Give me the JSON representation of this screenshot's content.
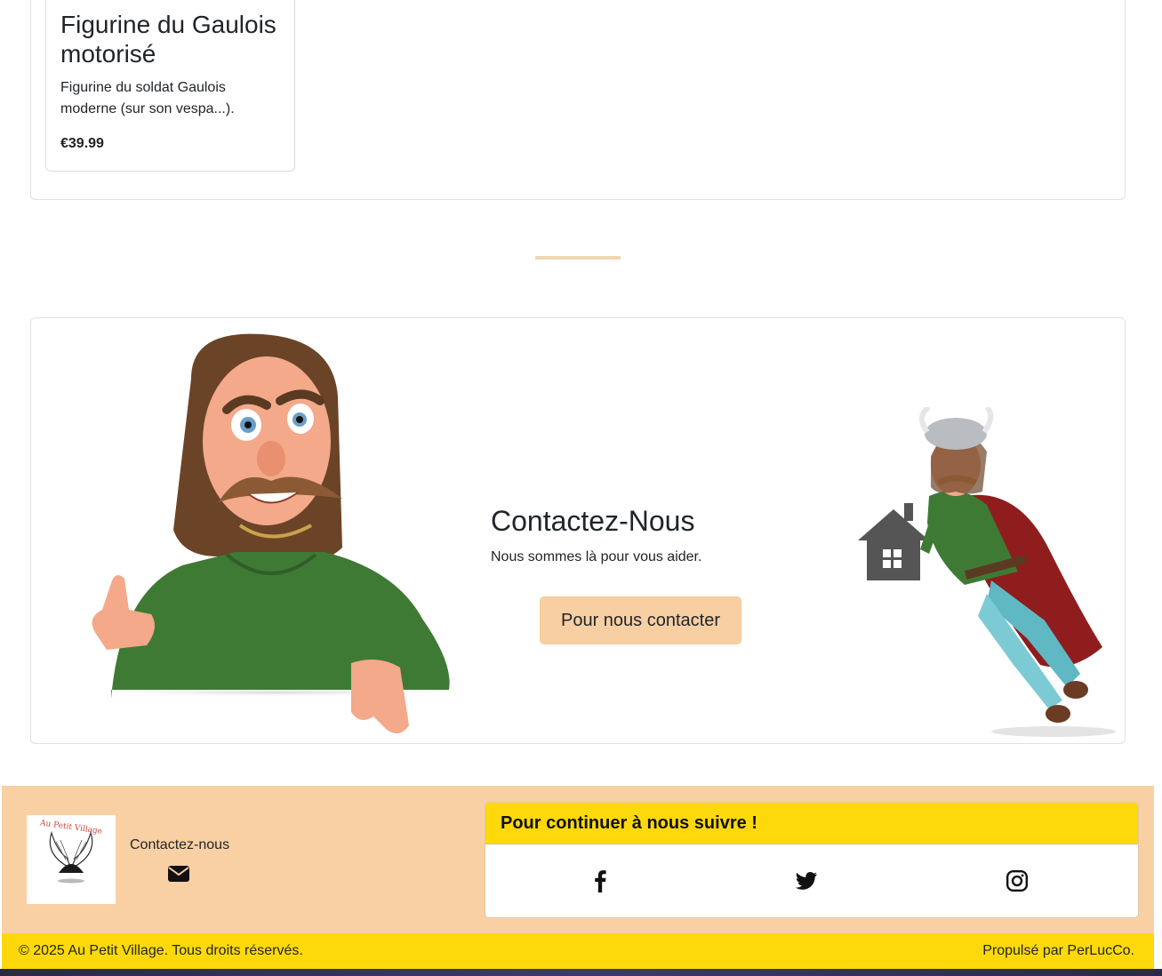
{
  "product": {
    "title": "Figurine du Gaulois motorisé",
    "description": "Figurine du soldat Gaulois moderne (sur son vespa...).",
    "price": "€39.99"
  },
  "contact": {
    "title": "Contactez-Nous",
    "subtitle": "Nous sommes là pour vous aider.",
    "button_label": "Pour nous contacter"
  },
  "footer": {
    "logo_text": "Au Petit Village",
    "contact_label": "Contactez-nous",
    "follow_title": "Pour continuer à nous suivre !",
    "social": [
      "facebook-icon",
      "twitter-icon",
      "instagram-icon"
    ],
    "copyright": "© 2025 Au Petit Village. Tous droits réservés.",
    "powered_by": "Propulsé par PerLucCo."
  },
  "colors": {
    "accent_peach": "#f8d0a4",
    "accent_yellow": "#fdd90c",
    "character_green": "#3f7a35"
  }
}
